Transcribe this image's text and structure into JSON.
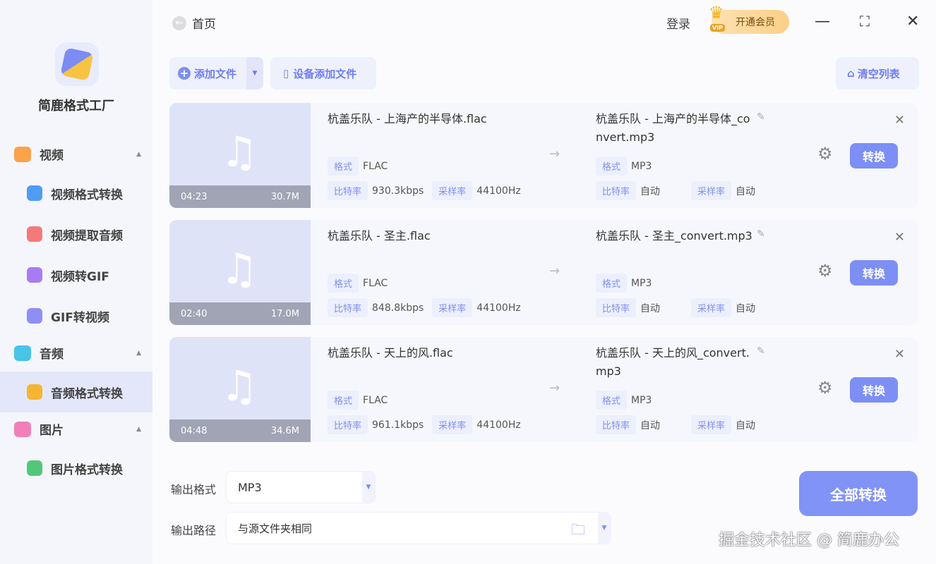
{
  "app": {
    "name": "简鹿格式工厂"
  },
  "sidebar": {
    "sections": [
      {
        "label": "视频",
        "color": "#fba24b",
        "items": [
          {
            "label": "视频格式转换",
            "color": "#4f9cf5"
          },
          {
            "label": "视频提取音频",
            "color": "#f47a7a"
          },
          {
            "label": "视频转GIF",
            "color": "#a77cf2"
          },
          {
            "label": "GIF转视频",
            "color": "#8e8ef5"
          }
        ]
      },
      {
        "label": "音频",
        "color": "#47c4e8",
        "items": [
          {
            "label": "音频格式转换",
            "color": "#f5b533"
          }
        ]
      },
      {
        "label": "图片",
        "color": "#f17fb8",
        "items": [
          {
            "label": "图片格式转换",
            "color": "#52c77a"
          }
        ]
      }
    ]
  },
  "header": {
    "home": "首页",
    "login": "登录",
    "vip": "开通会员",
    "vip_badge": "VIP"
  },
  "toolbar": {
    "add_file": "添加文件",
    "device_add": "设备添加文件",
    "clear": "清空列表"
  },
  "labels": {
    "format": "格式",
    "bitrate": "比特率",
    "samplerate": "采样率",
    "convert": "转换"
  },
  "files": [
    {
      "duration": "04:23",
      "size": "30.7M",
      "name": "杭盖乐队 - 上海产的半导体.flac",
      "format": "FLAC",
      "bitrate": "930.3kbps",
      "samplerate": "44100Hz",
      "out_name": "杭盖乐队 - 上海产的半导体_convert.mp3",
      "out_format": "MP3",
      "out_bitrate": "自动",
      "out_samplerate": "自动"
    },
    {
      "duration": "02:40",
      "size": "17.0M",
      "name": "杭盖乐队 - 圣主.flac",
      "format": "FLAC",
      "bitrate": "848.8kbps",
      "samplerate": "44100Hz",
      "out_name": "杭盖乐队 - 圣主_convert.mp3",
      "out_format": "MP3",
      "out_bitrate": "自动",
      "out_samplerate": "自动"
    },
    {
      "duration": "04:48",
      "size": "34.6M",
      "name": "杭盖乐队 - 天上的风.flac",
      "format": "FLAC",
      "bitrate": "961.1kbps",
      "samplerate": "44100Hz",
      "out_name": "杭盖乐队 - 天上的风_convert.mp3",
      "out_format": "MP3",
      "out_bitrate": "自动",
      "out_samplerate": "自动"
    }
  ],
  "output": {
    "format_label": "输出格式",
    "format_value": "MP3",
    "path_label": "输出路径",
    "path_value": "与源文件夹相同"
  },
  "convert_all": "全部转换",
  "watermark": "掘金技术社区 @ 简鹿办公"
}
